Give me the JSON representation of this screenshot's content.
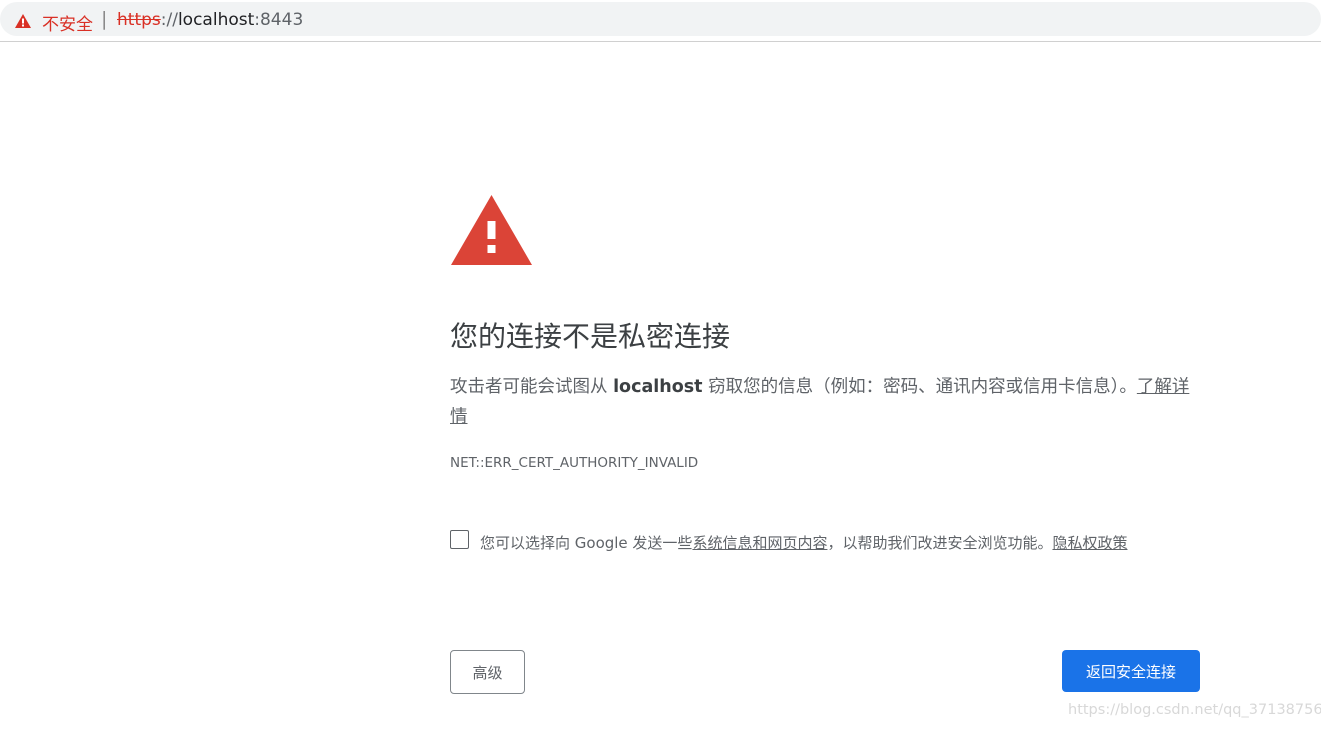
{
  "address_bar": {
    "security_label": "不安全",
    "separator": "|",
    "url_scheme": "https",
    "url_slashes": "://",
    "url_host": "localhost",
    "url_port": ":8443",
    "warning_icon": "warning-triangle-icon",
    "warning_color": "#d93025"
  },
  "interstitial": {
    "icon": "danger-triangle-icon",
    "icon_color": "#db4437",
    "title": "您的连接不是私密连接",
    "message_prefix": "攻击者可能会试图从 ",
    "message_host": "localhost",
    "message_suffix": " 窃取您的信息（例如：密码、通讯内容或信用卡信息）。",
    "learn_more_link": "了解详情",
    "error_code": "NET::ERR_CERT_AUTHORITY_INVALID",
    "optin": {
      "checked": false,
      "text_prefix": "您可以选择向 Google 发送一些",
      "link_system_info": "系统信息和网页内容",
      "text_middle": "，以帮助我们改进安全浏览功能。",
      "link_privacy": "隐私权政策"
    },
    "buttons": {
      "advanced_label": "高级",
      "back_label": "返回安全连接",
      "back_color": "#1a73e8"
    }
  },
  "watermark": "https://blog.csdn.net/qq_37138756"
}
